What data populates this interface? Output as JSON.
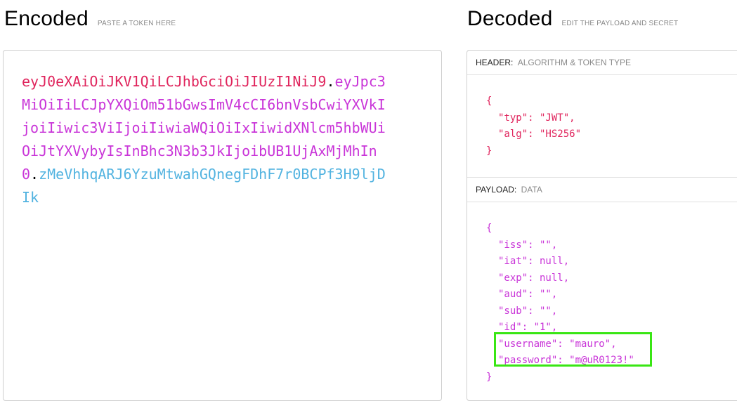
{
  "encoded": {
    "title": "Encoded",
    "subtitle": "PASTE A TOKEN HERE",
    "token": {
      "header": "eyJ0eXAiOiJKV1QiLCJhbGciOiJIUzI1NiJ9",
      "payload": "eyJpc3MiOiIiLCJpYXQiOm51bGwsImV4cCI6bnVsbCwiYXVkIjoiIiwic3ViIjoiIiwiaWQiOiIxIiwidXNlcm5hbWUiOiJtYXVybyIsInBhc3N3b3JkIjoibUB1UjAxMjMhIn0",
      "signature": "zMeVhhqARJ6YzuMtwahGQnegFDhF7r0BCPf3H9ljDIk",
      "dot": "."
    }
  },
  "decoded": {
    "title": "Decoded",
    "subtitle": "EDIT THE PAYLOAD AND SECRET",
    "header_section": {
      "label": "HEADER:",
      "sublabel": "ALGORITHM & TOKEN TYPE",
      "lines": [
        "{",
        "\"typ\": \"JWT\",",
        "\"alg\": \"HS256\"",
        "}"
      ]
    },
    "payload_section": {
      "label": "PAYLOAD:",
      "sublabel": "DATA",
      "lines": [
        "{",
        "\"iss\": \"\",",
        "\"iat\": null,",
        "\"exp\": null,",
        "\"aud\": \"\",",
        "\"sub\": \"\",",
        "\"id\": \"1\",",
        "\"username\": \"mauro\",",
        "\"password\": \"m@uR0123!\"",
        "}"
      ]
    }
  },
  "colors": {
    "header": "#e0255d",
    "payload": "#c935d8",
    "signature": "#52b3e0",
    "highlight": "#39e614"
  }
}
